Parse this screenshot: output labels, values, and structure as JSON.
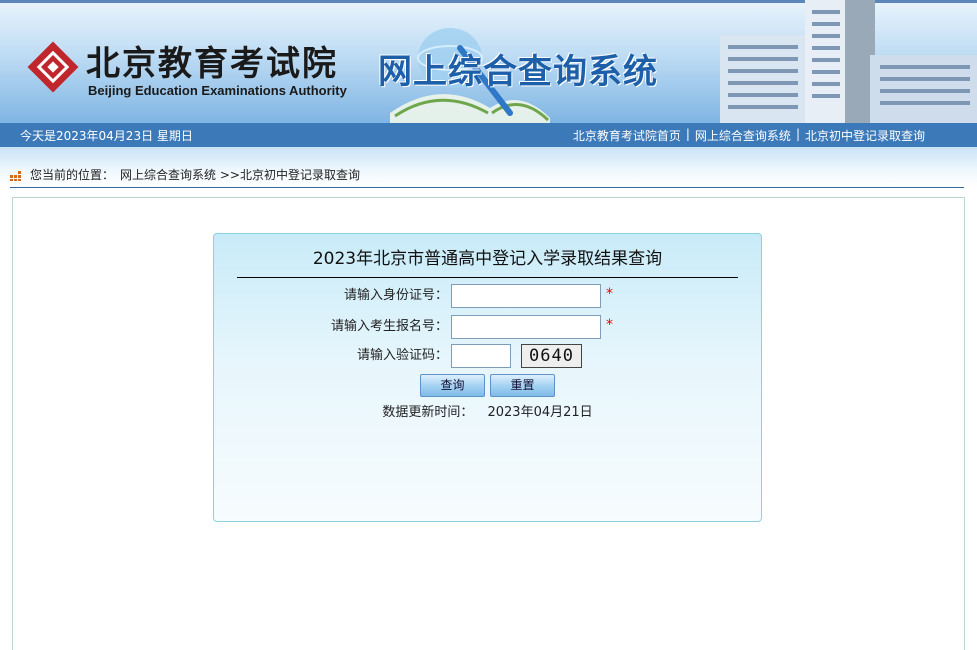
{
  "header": {
    "logo_cn": "北京教育考试院",
    "logo_en": "Beijing Education Examinations Authority",
    "system_title": "网上综合查询系统"
  },
  "navbar": {
    "date_text": "今天是2023年04月23日 星期日",
    "links": [
      "北京教育考试院首页",
      "网上综合查询系统",
      "北京初中登记录取查询"
    ],
    "separator": "|"
  },
  "breadcrumb": {
    "prefix": "您当前的位置：",
    "path": "网上综合查询系统 >>北京初中登记录取查询"
  },
  "query_form": {
    "title": "2023年北京市普通高中登记入学录取结果查询",
    "id_label": "请输入身份证号：",
    "id_value": "",
    "reg_label": "请输入考生报名号：",
    "reg_value": "",
    "captcha_label": "请输入验证码：",
    "captcha_value": "",
    "captcha_image_text": "0640",
    "required_mark": "*",
    "query_button": "查询",
    "reset_button": "重置",
    "update_label": "数据更新时间：",
    "update_date": "2023年04月21日"
  },
  "colors": {
    "nav_bar": "#3c79b8",
    "title_blue": "#1d5fa8",
    "panel_border": "#8cd1e3",
    "required": "#ee0000",
    "logo_red": "#c0272d"
  },
  "icons": [
    "logo-emblem-icon",
    "breadcrumb-grid-icon"
  ]
}
